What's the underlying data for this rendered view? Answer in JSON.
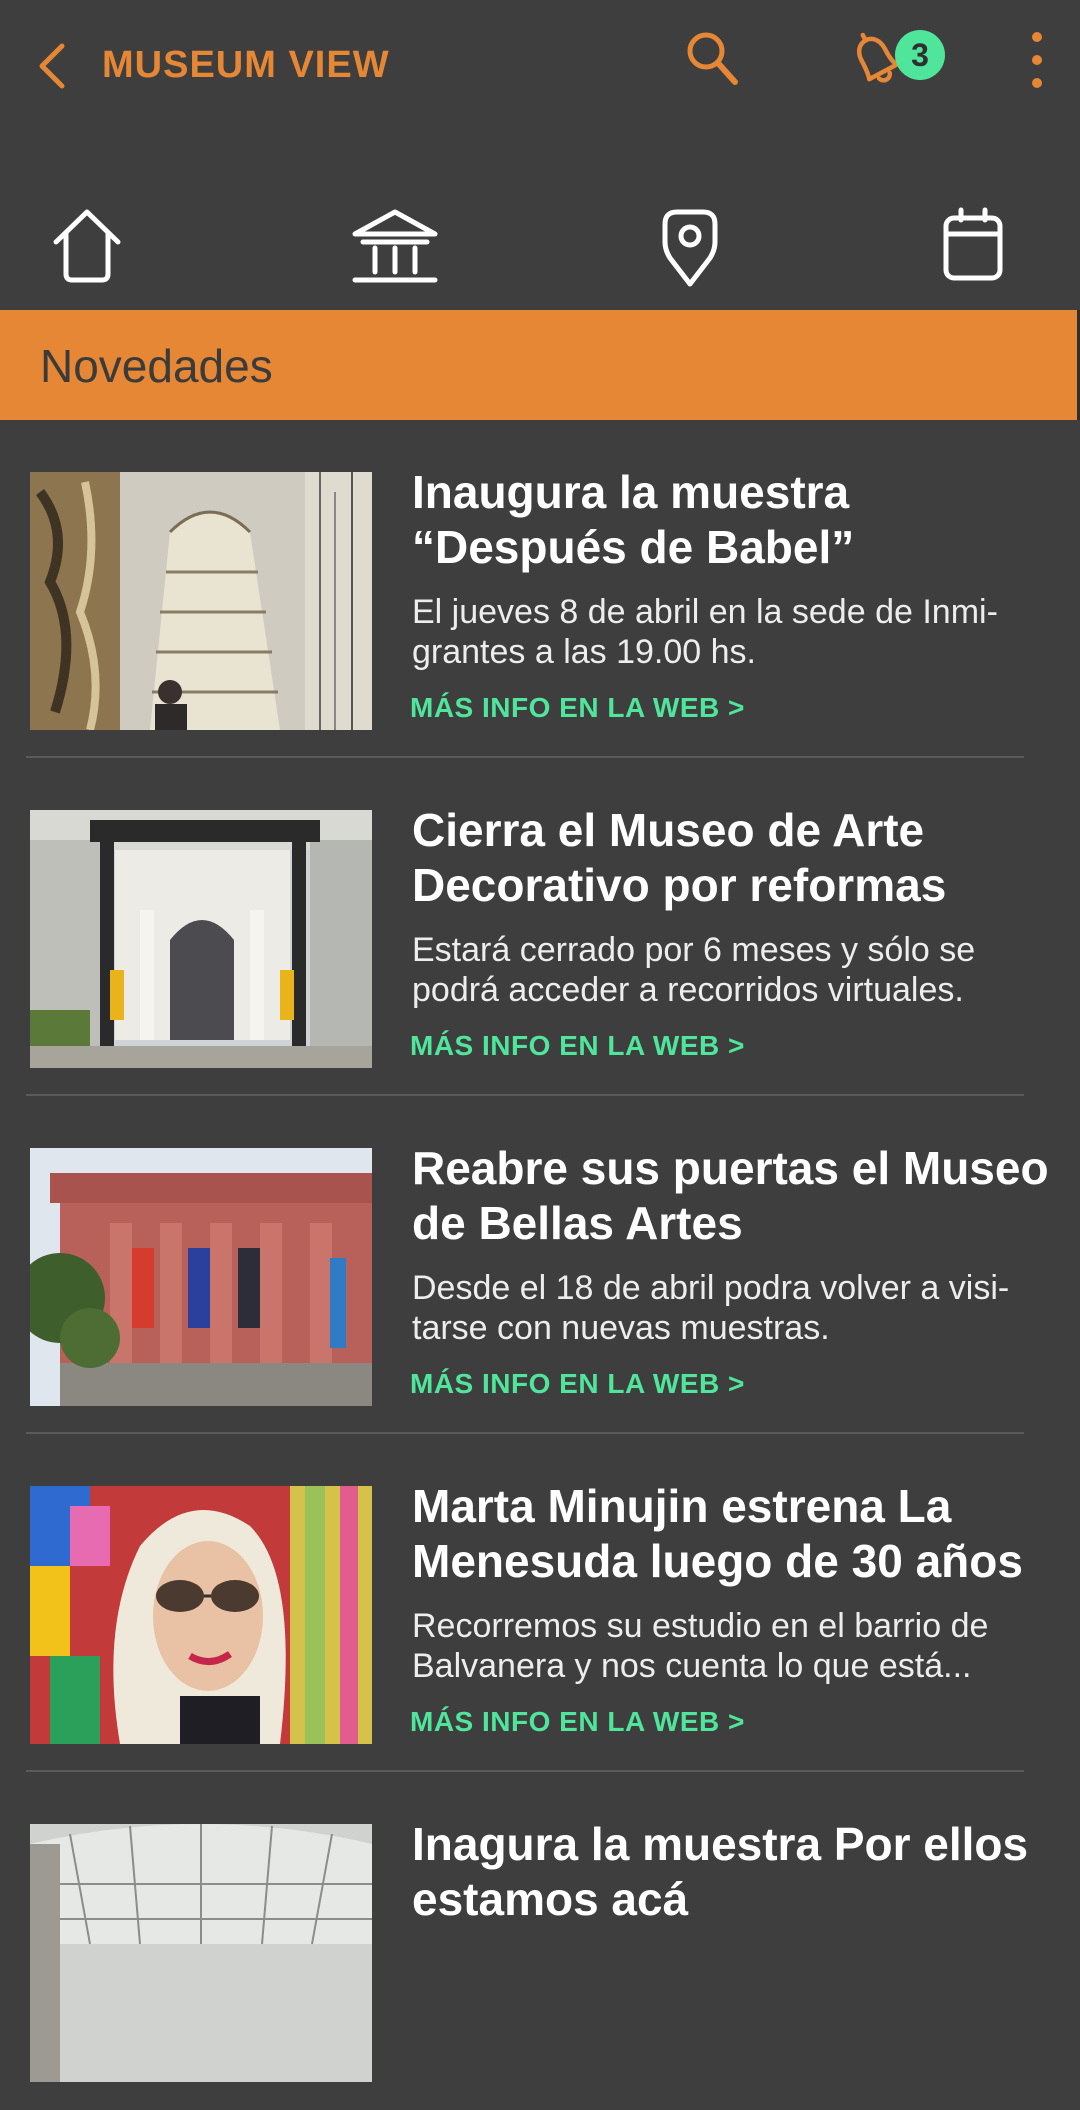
{
  "app_bar": {
    "title": "MUSEUM VIEW",
    "notification_count": "3",
    "icons": [
      "back-icon",
      "search-icon",
      "bell-icon",
      "more-vertical-icon"
    ]
  },
  "nav": {
    "icons": [
      "home-icon",
      "museum-icon",
      "location-pin-icon",
      "calendar-icon"
    ]
  },
  "section": {
    "title": "Novedades"
  },
  "news": [
    {
      "title": "Inaugura la muestra “Después de Babel”",
      "summary": "El jueves 8 de abril en la sede de Inmi-grantes a las 19.00 hs.",
      "link": "MÁS INFO EN LA WEB >"
    },
    {
      "title": "Cierra el Museo de Arte Decorativo por reformas",
      "summary": "Estará cerrado por 6 meses y sólo se podrá acceder a recorridos virtuales.",
      "link": "MÁS INFO EN LA WEB >"
    },
    {
      "title": "Reabre sus puertas el Museo de Bellas Artes",
      "summary": "Desde el 18 de abril podra volver a visi-tarse con nuevas muestras.",
      "link": "MÁS INFO EN LA WEB >"
    },
    {
      "title": "Marta Minujin estrena La Menesuda luego de 30 años",
      "summary": "Recorremos su estudio en el barrio de Balvanera y nos cuenta lo que está...",
      "link": "MÁS INFO EN LA WEB >"
    },
    {
      "title": "Inagura la muestra Por ellos estamos acá",
      "summary": "",
      "link": ""
    }
  ],
  "colors": {
    "background": "#3e3e3e",
    "accent": "#e58735",
    "link": "#4fe69c",
    "text": "#ffffff"
  }
}
